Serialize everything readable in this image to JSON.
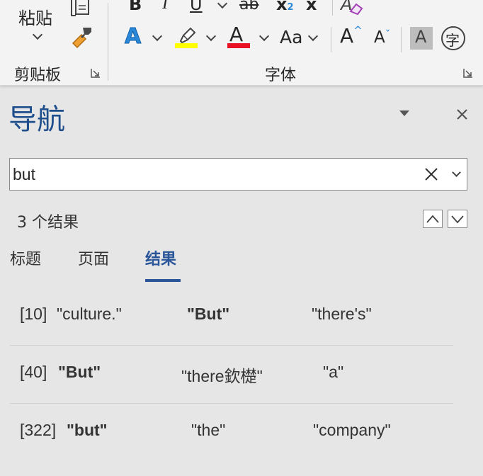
{
  "ribbon": {
    "clipboard": {
      "paste_label": "粘贴",
      "group_label": "剪贴板"
    },
    "font": {
      "group_label": "字体",
      "bold_glyph": "B",
      "italic_glyph": "I",
      "underline_glyph": "U",
      "strikethrough_glyph": "ab",
      "subscript_glyph": "x",
      "subscript_index": "2",
      "superscript_glyph": "x",
      "text_effects_glyph": "A",
      "font_color_glyph": "A",
      "change_case_glyph": "Aa",
      "grow_font_glyph": "A",
      "shrink_font_glyph": "A",
      "char_shading_glyph": "A",
      "enclose_char_glyph": "字",
      "highlight_color": "#ffff00",
      "font_color": "#e81123",
      "text_effects_color": "#2b88d8"
    }
  },
  "nav": {
    "title": "导航",
    "search_value": "but",
    "result_count": "3 个结果",
    "tabs": [
      {
        "label": "标题"
      },
      {
        "label": "页面"
      },
      {
        "label": "结果"
      }
    ],
    "results": [
      {
        "num": "[10]",
        "before": "\"culture.\"",
        "match": "\"But\"",
        "after": "\"there's\""
      },
      {
        "num": "[40]",
        "before": "\"But\"",
        "match": "\"there欽檚\"",
        "after": "\"a\""
      },
      {
        "num": "[322]",
        "before": "\"but\"",
        "match": "\"the\"",
        "after": "\"company\""
      }
    ]
  }
}
